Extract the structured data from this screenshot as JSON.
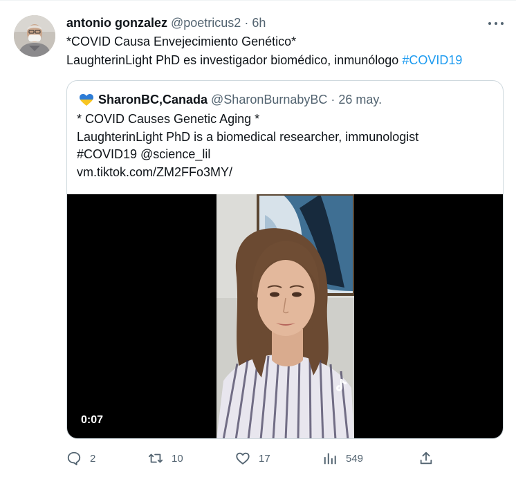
{
  "tweet": {
    "display_name": "antonio gonzalez",
    "handle": "@poetricus2",
    "separator": "·",
    "time": "6h",
    "text_line1": "*COVID Causa Envejecimiento Genético*",
    "text_line2_prefix": "LaughterinLight PhD es investigador biomédico, inmunólogo ",
    "text_line2_hashtag": "#COVID19"
  },
  "quote": {
    "display_name": "SharonBC,Canada",
    "handle": "@SharonBurnabyBC",
    "separator": "·",
    "time": "26 may.",
    "flag_icon": "ukraine-heart",
    "lines": [
      "* COVID Causes Genetic Aging *",
      "LaughterinLight PhD is a biomedical researcher, immunologist",
      "#COVID19 @science_lil",
      "vm.tiktok.com/ZM2FFo3MY/"
    ],
    "video": {
      "duration": "0:07",
      "watermark": "TikTok"
    }
  },
  "actions": {
    "reply_count": "2",
    "retweet_count": "10",
    "like_count": "17",
    "views_count": "549"
  },
  "colors": {
    "accent": "#1d9bf0",
    "secondary_text": "#536471",
    "border": "#cfd9de"
  }
}
